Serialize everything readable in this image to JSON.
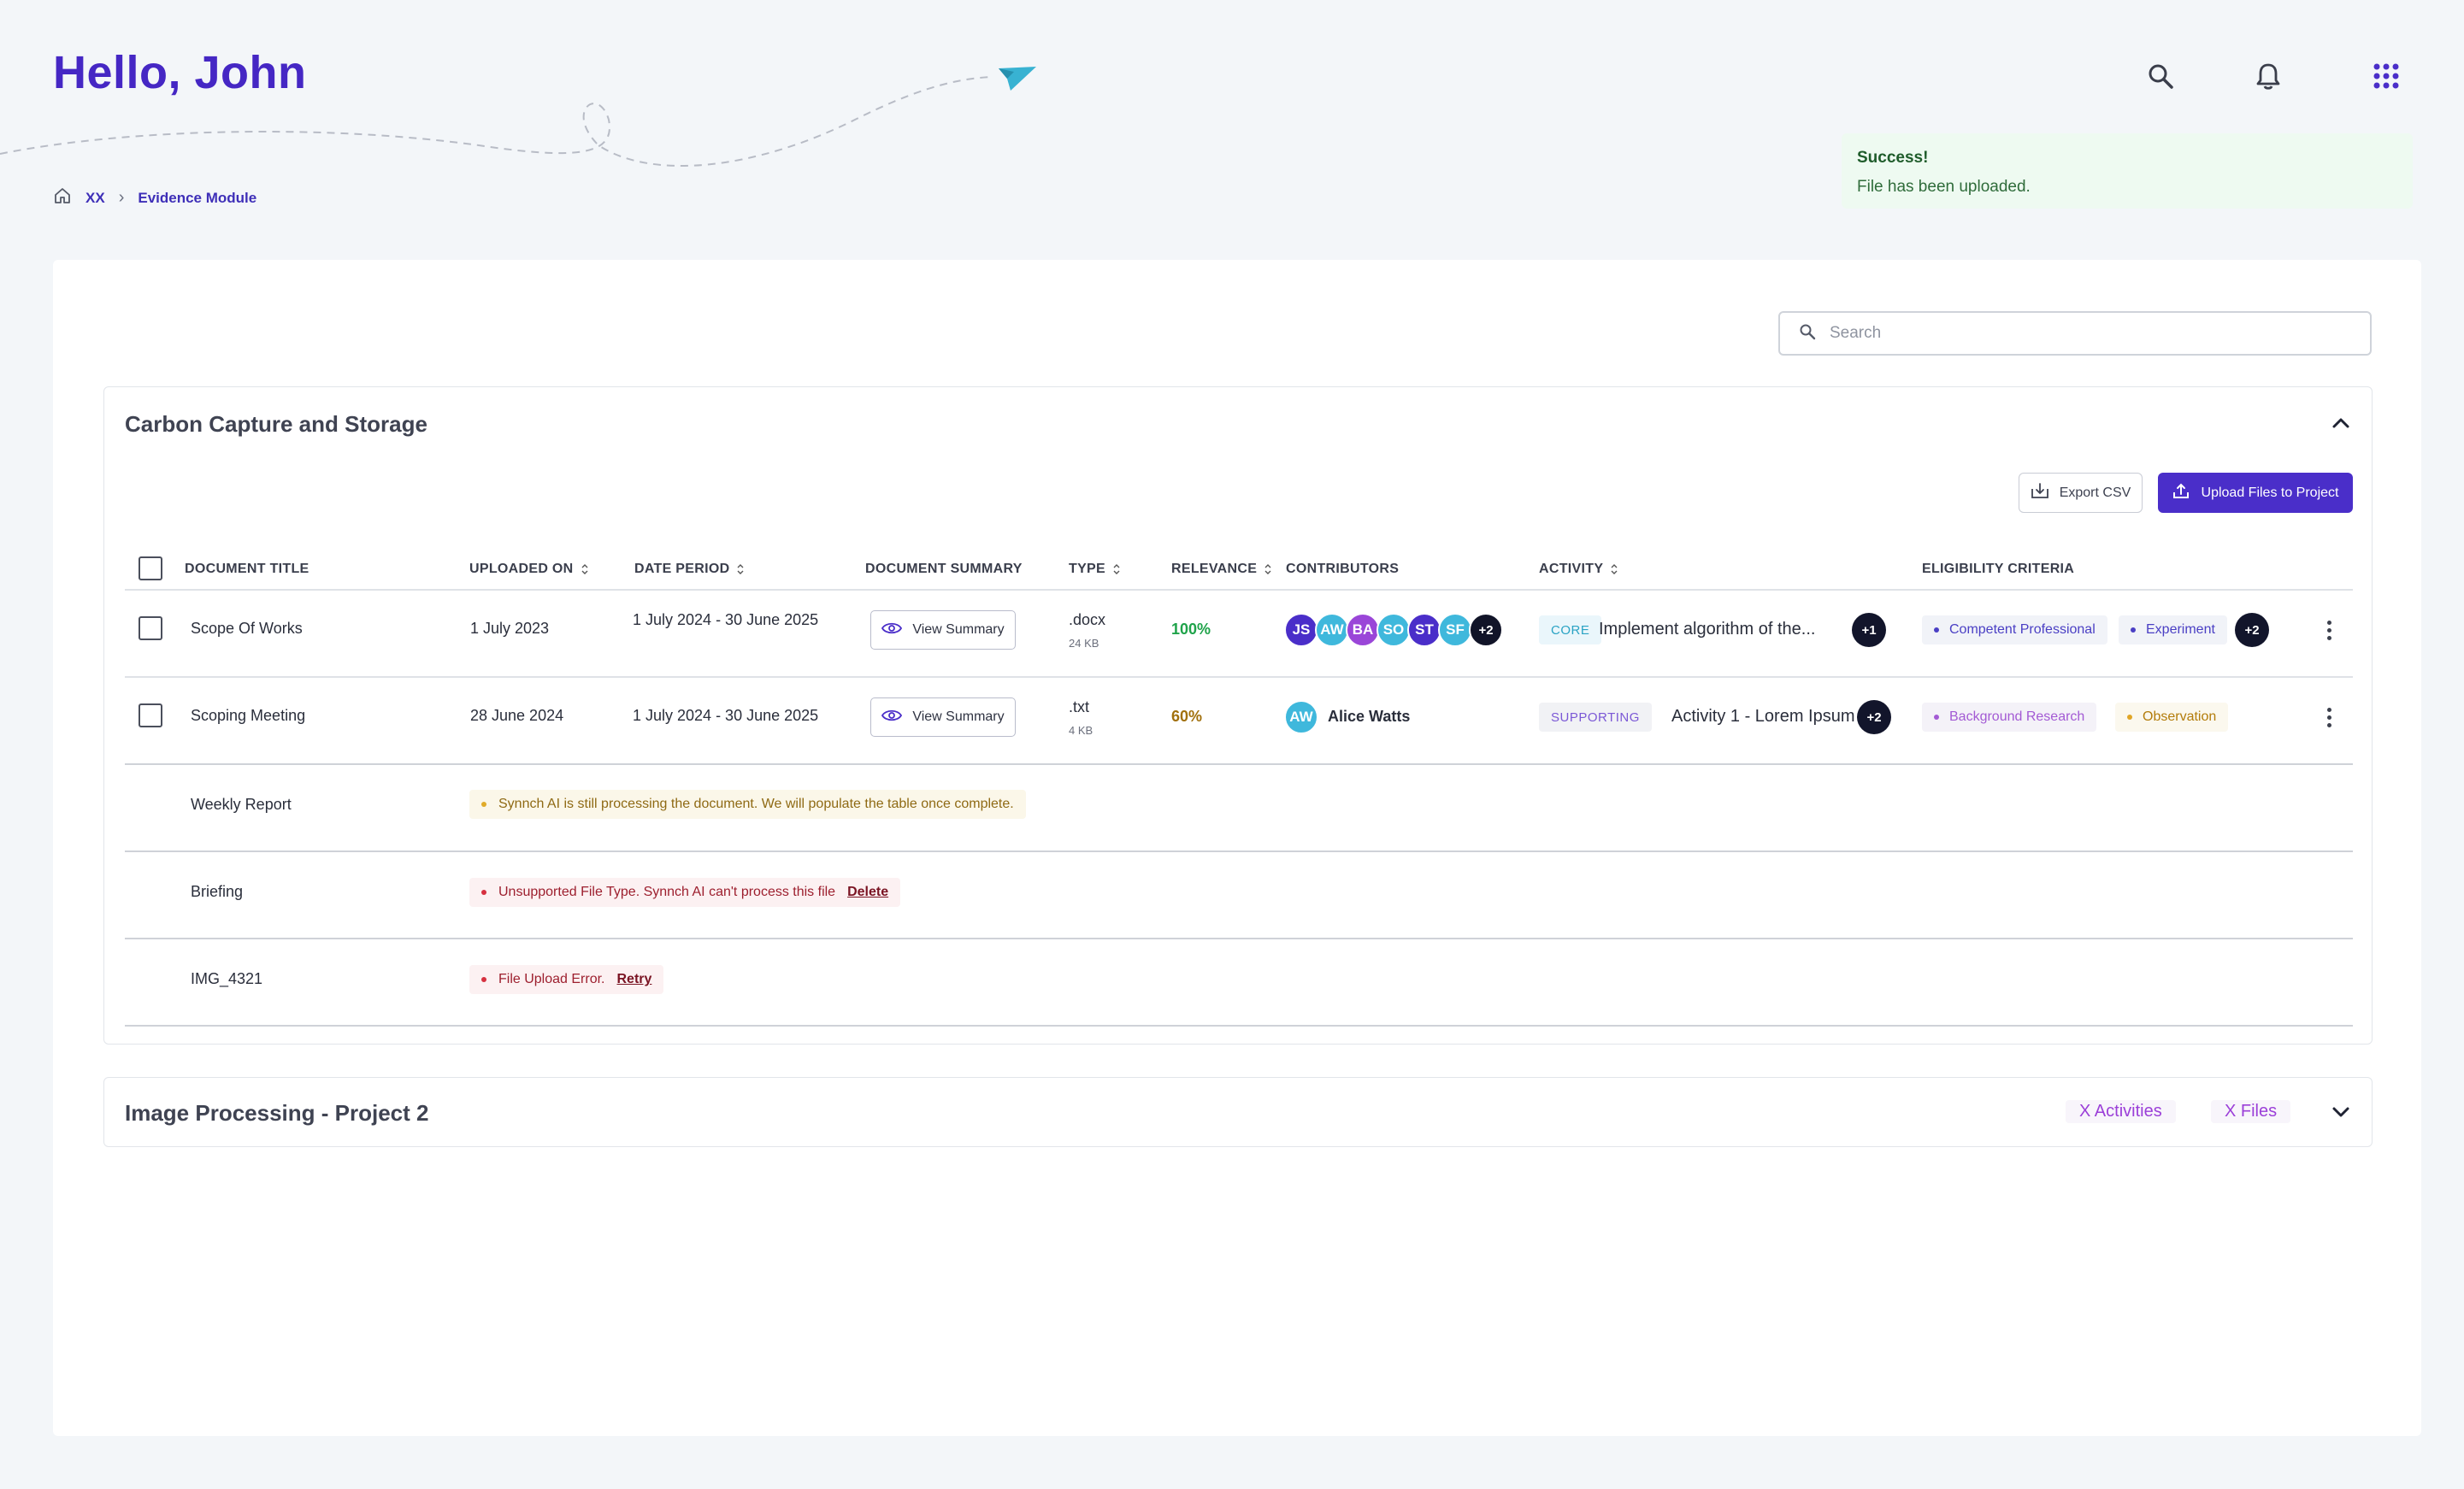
{
  "header": {
    "greeting": "Hello, John"
  },
  "breadcrumb": {
    "items": [
      "XX",
      "Evidence Module"
    ]
  },
  "toast": {
    "title": "Success!",
    "message": "File has been uploaded."
  },
  "search": {
    "placeholder": "Search"
  },
  "project1": {
    "title": "Carbon Capture and Storage",
    "export_label": "Export CSV",
    "upload_label": "Upload Files to Project",
    "columns": {
      "title": "DOCUMENT TITLE",
      "uploaded": "UPLOADED ON",
      "period": "DATE PERIOD",
      "summary": "DOCUMENT SUMMARY",
      "type": "TYPE",
      "relevance": "RELEVANCE",
      "contributors": "CONTRIBUTORS",
      "activity": "ACTIVITY",
      "criteria": "ELIGIBILITY CRITERIA"
    },
    "rows": [
      {
        "title": "Scope Of Works",
        "uploaded": "1 July 2023",
        "period": "1 July 2024 - 30 June 2025",
        "summary_label": "View Summary",
        "type": ".docx",
        "size": "24 KB",
        "relevance": "100%",
        "contributors": [
          "JS",
          "AW",
          "BA",
          "SO",
          "ST",
          "SF"
        ],
        "contributors_more": "+2",
        "activity_tag": "CORE",
        "activity": "Implement algorithm of the...",
        "activity_more": "+1",
        "criteria": [
          "Competent Professional",
          "Experiment"
        ],
        "criteria_more": "+2"
      },
      {
        "title": "Scoping Meeting",
        "uploaded": "28 June 2024",
        "period": "1 July 2024 - 30 June 2025",
        "summary_label": "View Summary",
        "type": ".txt",
        "size": "4 KB",
        "relevance": "60%",
        "contributor_initials": "AW",
        "contributor_name": "Alice Watts",
        "activity_tag": "SUPPORTING",
        "activity": "Activity 1 - Lorem Ipsum",
        "activity_more": "+2",
        "criteria": [
          "Background Research",
          "Observation"
        ]
      }
    ],
    "pending": [
      {
        "title": "Weekly Report",
        "message": "Synnch AI is still processing the document. We will populate the table once complete."
      },
      {
        "title": "Briefing",
        "message": "Unsupported File Type. Synnch AI can't process this file",
        "action": "Delete"
      },
      {
        "title": "IMG_4321",
        "message": "File Upload Error.",
        "action": "Retry"
      }
    ]
  },
  "project2": {
    "title": "Image Processing - Project 2",
    "activities_label": "X Activities",
    "files_label": "X Files"
  },
  "colors": {
    "brand": "#4527c4",
    "relevance_high": "#1fa34a",
    "relevance_mid": "#a1700c"
  }
}
